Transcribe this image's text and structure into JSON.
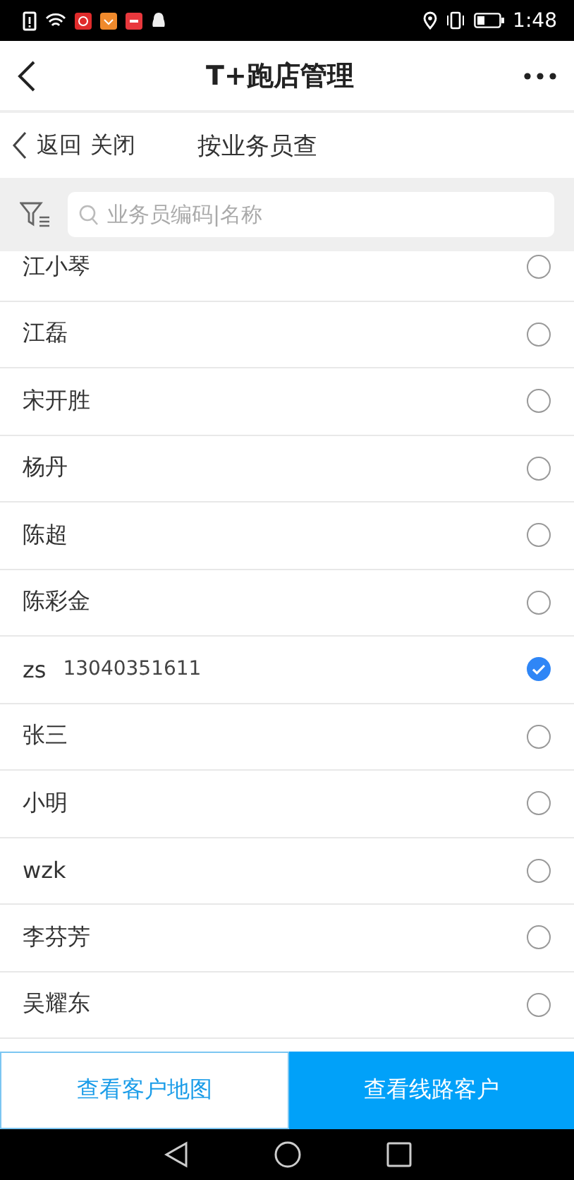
{
  "status_bar": {
    "time": "1:48"
  },
  "header": {
    "title": "T+跑店管理"
  },
  "sub_header": {
    "back": "返回",
    "close": "关闭",
    "title": "按业务员查"
  },
  "search": {
    "placeholder": "业务员编码|名称"
  },
  "salespeople": [
    {
      "name": "江小琴",
      "selected": false
    },
    {
      "name": "江磊",
      "selected": false
    },
    {
      "name": "宋开胜",
      "selected": false
    },
    {
      "name": "杨丹",
      "selected": false
    },
    {
      "name": "陈超",
      "selected": false
    },
    {
      "name": "陈彩金",
      "selected": false
    },
    {
      "name": "zs",
      "code": "13040351611",
      "selected": true
    },
    {
      "name": "张三",
      "selected": false
    },
    {
      "name": "小明",
      "selected": false
    },
    {
      "name": "wzk",
      "selected": false
    },
    {
      "name": "李芬芳",
      "selected": false
    },
    {
      "name": "吴耀东",
      "selected": false
    }
  ],
  "buttons": [
    {
      "label": "查看客户地图",
      "kind": "outline"
    },
    {
      "label": "查看线路客户",
      "kind": "primary"
    }
  ]
}
